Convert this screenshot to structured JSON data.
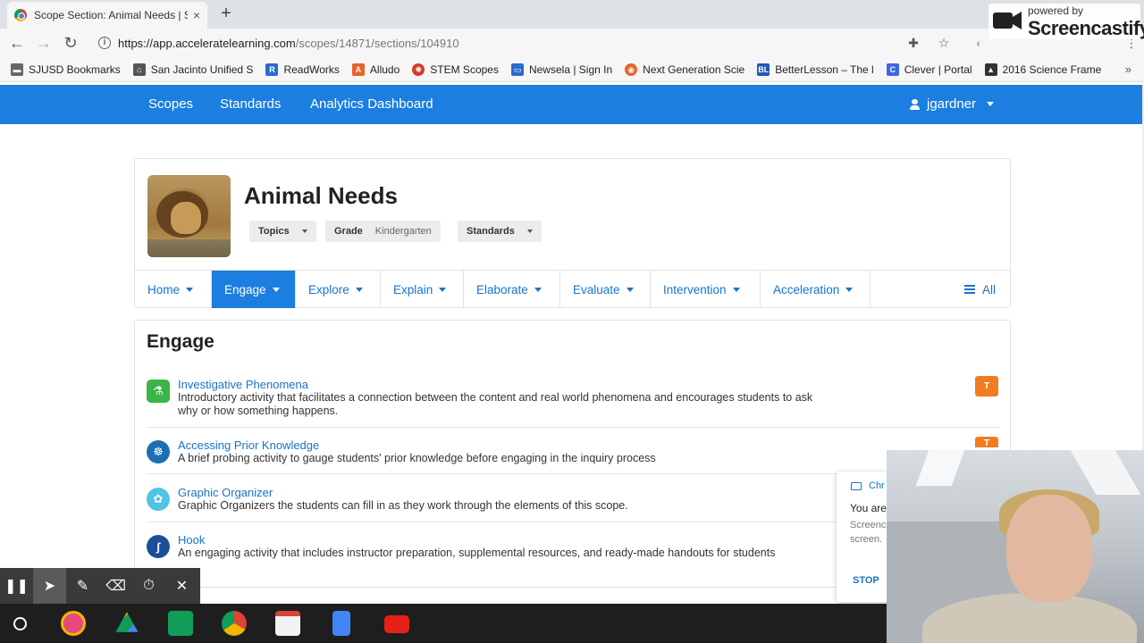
{
  "browser": {
    "tab_title": "Scope Section: Animal Needs | S",
    "tab_close": "×",
    "new_tab": "+",
    "url_host": "https://app.acceleratelearning.com",
    "url_path": "/scopes/14871/sections/104910",
    "bookmarks": [
      {
        "label": "SJUSD Bookmarks",
        "icon": "folder-icon",
        "color": "#666666"
      },
      {
        "label": "San Jacinto Unified S",
        "icon": "school-icon",
        "color": "#555555"
      },
      {
        "label": "ReadWorks",
        "icon": "readworks-icon",
        "color": "#2a6bd1"
      },
      {
        "label": "Alludo",
        "icon": "alludo-icon",
        "color": "#e8622a"
      },
      {
        "label": "STEM Scopes",
        "icon": "stemscopes-icon",
        "color": "#d63a2a"
      },
      {
        "label": "Newsela | Sign In",
        "icon": "newsela-icon",
        "color": "#2a6bd1"
      },
      {
        "label": "Next Generation Scie",
        "icon": "ngss-icon",
        "color": "#e8622a"
      },
      {
        "label": "BetterLesson – The l",
        "icon": "betterlesson-icon",
        "color": "#1f56b8"
      },
      {
        "label": "Clever | Portal",
        "icon": "clever-icon",
        "color": "#3c65e6"
      },
      {
        "label": "2016 Science Frame",
        "icon": "graduation-cap-icon",
        "color": "#333333"
      }
    ],
    "bookmarks_more": "»"
  },
  "watermark": {
    "powered_by": "powered by",
    "brand": "Screencastify"
  },
  "app_nav": {
    "links": [
      "Scopes",
      "Standards",
      "Analytics Dashboard"
    ],
    "user": "jgardner"
  },
  "scope": {
    "title": "Animal Needs",
    "topics_label": "Topics",
    "grade_label": "Grade",
    "grade_value": "Kindergarten",
    "standards_label": "Standards",
    "tabs": [
      "Home",
      "Engage",
      "Explore",
      "Explain",
      "Elaborate",
      "Evaluate",
      "Intervention",
      "Acceleration"
    ],
    "active_tab": "Engage",
    "all_label": "All"
  },
  "section": {
    "title": "Engage",
    "activities": [
      {
        "title": "Investigative Phenomena",
        "desc": "Introductory activity that facilitates a connection between the content and real world phenomena and encourages students to ask why or how something happens.",
        "icon": "microscope-icon",
        "color": "#3bb54a",
        "badge": "T"
      },
      {
        "title": "Accessing Prior Knowledge",
        "desc": "A brief probing activity to gauge students' prior knowledge before engaging in the inquiry process",
        "icon": "brain-icon",
        "color": "#1e6eb5",
        "badge": "T"
      },
      {
        "title": "Graphic Organizer",
        "desc": "Graphic Organizers the students can fill in as they work through the elements of this scope.",
        "icon": "organizer-icon",
        "color": "#4fc3e8",
        "badge": ""
      },
      {
        "title": "Hook",
        "desc": "An engaging activity that includes instructor preparation, supplemental resources, and ready-made handouts for students",
        "icon": "hook-icon",
        "color": "#1b4f9c",
        "badge": ""
      }
    ]
  },
  "notification": {
    "header": "Chr",
    "line1": "You are",
    "line2": "Screenc",
    "line3": "screen.",
    "stop": "STOP"
  },
  "colors": {
    "accent": "#1b7ee0",
    "badge": "#f47c20",
    "link": "#1a73c8"
  }
}
